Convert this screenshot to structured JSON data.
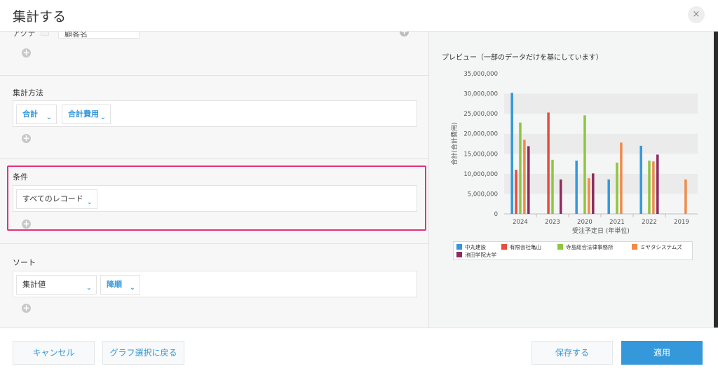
{
  "dialog": {
    "title": "集計する",
    "close_glyph": "×"
  },
  "top_partial": {
    "label_partial": "アクテ",
    "field_partial": "顧客名"
  },
  "aggregation": {
    "label": "集計方法",
    "method": "合計",
    "field": "合計費用"
  },
  "condition": {
    "label": "条件",
    "value": "すべてのレコード"
  },
  "sort": {
    "label": "ソート",
    "by": "集計値",
    "order": "降順"
  },
  "plus_glyph": "+",
  "preview": {
    "title": "プレビュー（一部のデータだけを基にしています）"
  },
  "chart_data": {
    "type": "bar",
    "xlabel": "受注予定日 (年単位)",
    "ylabel": "合計(合計費用)",
    "ylim": [
      0,
      35000000
    ],
    "yticks": [
      "0",
      "5,000,000",
      "10,000,000",
      "15,000,000",
      "20,000,000",
      "25,000,000",
      "30,000,000",
      "35,000,000"
    ],
    "categories": [
      "2024",
      "2023",
      "2020",
      "2021",
      "2022",
      "2019"
    ],
    "series": [
      {
        "name": "中丸建設",
        "color": "#3498db",
        "values": [
          30200000,
          0,
          13300000,
          8600000,
          17000000,
          0
        ]
      },
      {
        "name": "有限会社亀山",
        "color": "#e74c3c",
        "values": [
          11000000,
          25300000,
          0,
          0,
          0,
          0
        ]
      },
      {
        "name": "寺島総合法律事務所",
        "color": "#8ec63f",
        "values": [
          22800000,
          13500000,
          24600000,
          12800000,
          13300000,
          0
        ]
      },
      {
        "name": "ミヤタシステムズ",
        "color": "#f08a4b",
        "values": [
          18500000,
          0,
          8900000,
          17800000,
          13100000,
          8600000
        ]
      },
      {
        "name": "池田学院大学",
        "color": "#8e2a5e",
        "values": [
          16900000,
          8600000,
          10100000,
          0,
          14800000,
          0
        ]
      }
    ]
  },
  "footer": {
    "cancel": "キャンセル",
    "back": "グラフ選択に戻る",
    "save": "保存する",
    "apply": "適用"
  }
}
